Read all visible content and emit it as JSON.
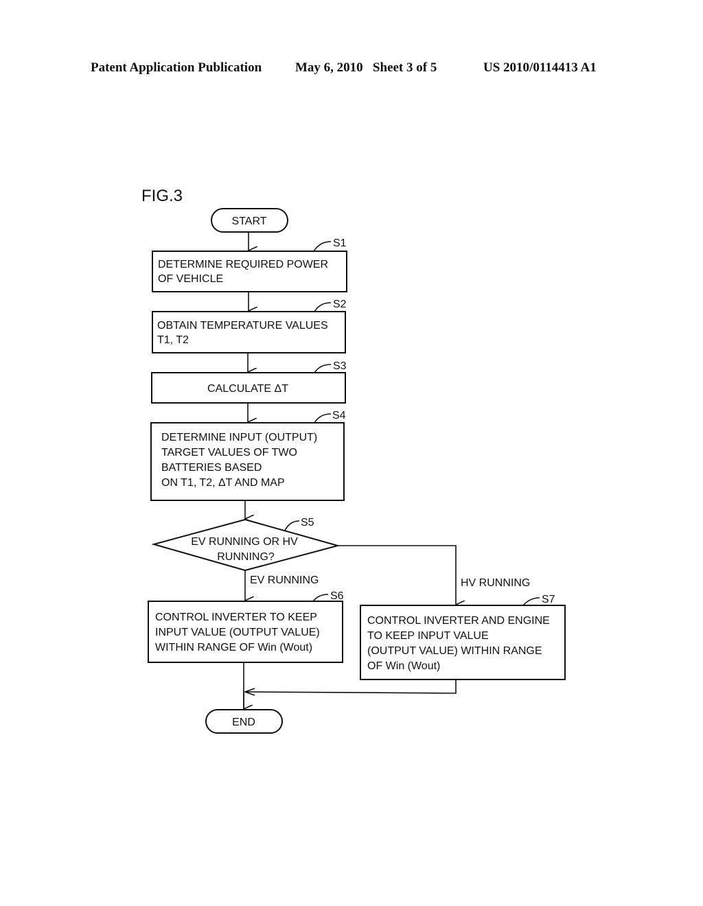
{
  "header": {
    "publication": "Patent Application Publication",
    "date_sheet": "May 6, 2010   Sheet 3 of 5",
    "number": "US 2010/0114413 A1"
  },
  "figure": {
    "label": "FIG.3",
    "start": "START",
    "end": "END",
    "steps": [
      {
        "id": "S1",
        "lines": [
          "DETERMINE REQUIRED POWER",
          "OF VEHICLE"
        ]
      },
      {
        "id": "S2",
        "lines": [
          "OBTAIN TEMPERATURE VALUES",
          "T1, T2"
        ]
      },
      {
        "id": "S3",
        "lines": [
          "CALCULATE ΔT"
        ]
      },
      {
        "id": "S4",
        "lines": [
          "DETERMINE INPUT (OUTPUT)",
          "TARGET VALUES OF TWO",
          "BATTERIES BASED",
          "ON T1, T2, ΔT AND MAP"
        ]
      },
      {
        "id": "S5",
        "lines": [
          "EV RUNNING OR HV",
          "RUNNING?"
        ]
      },
      {
        "id": "S6",
        "lines": [
          "CONTROL INVERTER TO KEEP",
          "INPUT VALUE (OUTPUT VALUE)",
          "WITHIN RANGE OF Win (Wout)"
        ]
      },
      {
        "id": "S7",
        "lines": [
          "CONTROL INVERTER AND ENGINE",
          "TO KEEP INPUT VALUE",
          "(OUTPUT VALUE) WITHIN RANGE",
          "OF Win (Wout)"
        ]
      }
    ],
    "branches": {
      "ev": "EV RUNNING",
      "hv": "HV RUNNING"
    }
  }
}
